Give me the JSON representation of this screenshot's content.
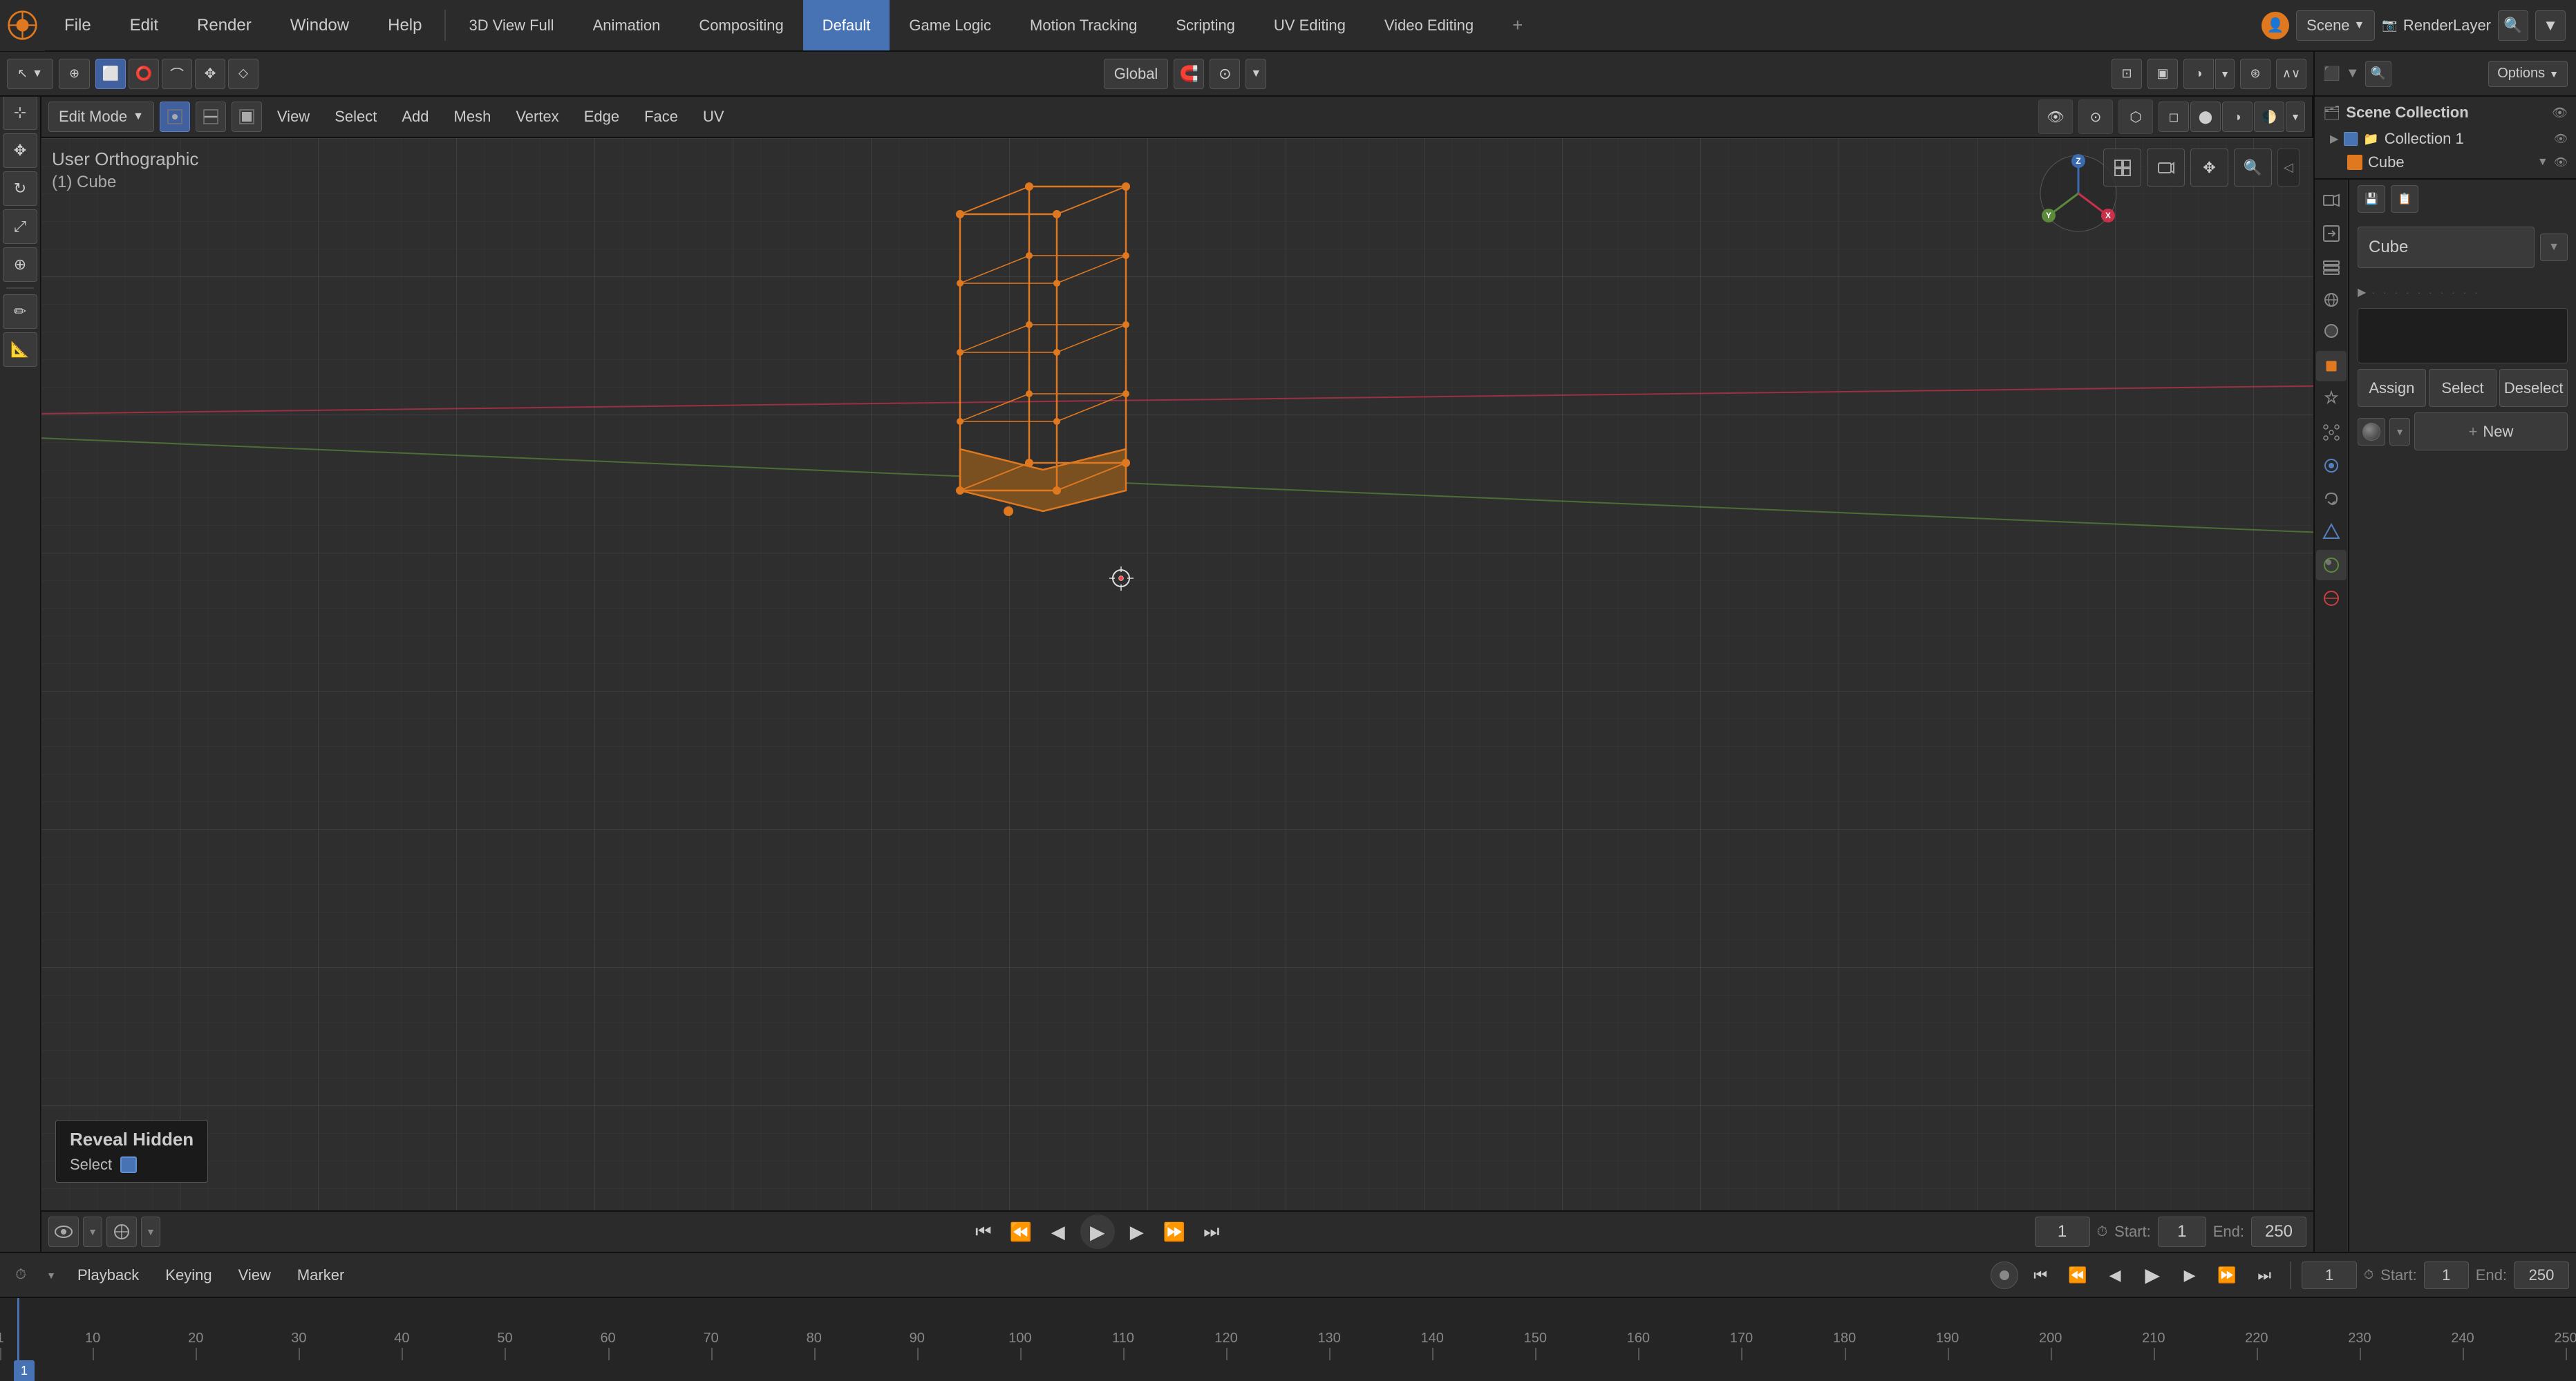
{
  "app": {
    "title": "Blender"
  },
  "top_menu": {
    "items": [
      {
        "id": "file",
        "label": "File"
      },
      {
        "id": "edit",
        "label": "Edit"
      },
      {
        "id": "render",
        "label": "Render"
      },
      {
        "id": "window",
        "label": "Window"
      },
      {
        "id": "help",
        "label": "Help"
      }
    ],
    "workspaces": [
      {
        "id": "3dview",
        "label": "3D View Full"
      },
      {
        "id": "animation",
        "label": "Animation"
      },
      {
        "id": "compositing",
        "label": "Compositing"
      },
      {
        "id": "default",
        "label": "Default",
        "active": true
      },
      {
        "id": "gamelogic",
        "label": "Game Logic"
      },
      {
        "id": "motiontracking",
        "label": "Motion Tracking"
      },
      {
        "id": "scripting",
        "label": "Scripting"
      },
      {
        "id": "uvediting",
        "label": "UV Editing"
      },
      {
        "id": "videoediting",
        "label": "Video Editing"
      }
    ],
    "add_workspace": "+",
    "scene_label": "Scene",
    "render_layer_label": "RenderLayer",
    "search_placeholder": "Search..."
  },
  "viewport": {
    "mode_label": "User Orthographic",
    "object_label": "(1) Cube",
    "transform_space": "Global",
    "global_dropdown_label": "Global",
    "cursor_label": "3D Cursor"
  },
  "viewport_header": {
    "mode": "Edit Mode",
    "menus": [
      "View",
      "Select",
      "Add",
      "Mesh",
      "Vertex",
      "Edge",
      "Face",
      "UV"
    ]
  },
  "left_tools": {
    "tools": [
      {
        "id": "select",
        "icon": "↖",
        "active": true
      },
      {
        "id": "move",
        "icon": "✥"
      },
      {
        "id": "rotate",
        "icon": "↻"
      },
      {
        "id": "scale",
        "icon": "⤢"
      },
      {
        "id": "transform",
        "icon": "⊕"
      },
      {
        "id": "annotate",
        "icon": "✏"
      },
      {
        "id": "measure",
        "icon": "📏"
      },
      {
        "id": "cursor",
        "icon": "⊹"
      }
    ]
  },
  "right_panel": {
    "scene_collection": {
      "title": "Scene Collection",
      "items": [
        {
          "label": "Collection 1",
          "icon": "folder",
          "visible": true,
          "children": [
            {
              "label": "Cube",
              "icon": "cube",
              "visible": true
            }
          ]
        }
      ]
    },
    "object_name": "Cube",
    "tabs": [
      {
        "id": "render",
        "icon": "📷",
        "active": false
      },
      {
        "id": "output",
        "icon": "🖨"
      },
      {
        "id": "view_layer",
        "icon": "🗂"
      },
      {
        "id": "scene",
        "icon": "🎬"
      },
      {
        "id": "world",
        "icon": "🌐"
      },
      {
        "id": "object",
        "icon": "🟧"
      },
      {
        "id": "modifier",
        "icon": "🔧"
      },
      {
        "id": "particles",
        "icon": "✨"
      },
      {
        "id": "physics",
        "icon": "🔵"
      },
      {
        "id": "constraint",
        "icon": "🔗"
      },
      {
        "id": "data",
        "icon": "△"
      },
      {
        "id": "material",
        "icon": "🟠",
        "active": true
      },
      {
        "id": "texture",
        "icon": "🔴"
      }
    ],
    "material": {
      "assign_label": "Assign",
      "select_label": "Select",
      "deselect_label": "Deselect",
      "new_label": "New",
      "add_icon": "+",
      "sphere_icon": "●"
    }
  },
  "bottom": {
    "edit_mode_label": "Edit Mode",
    "vert_btn": "▲",
    "edge_btn": "—",
    "face_btn": "□",
    "playback_label": "Playback",
    "keying_label": "Keying",
    "view_label": "View",
    "marker_label": "Marker",
    "play_icon": "▶",
    "frame_current": "1",
    "start_label": "Start:",
    "start_value": "1",
    "end_label": "End:",
    "end_value": "250",
    "frame_markers": [
      {
        "value": 1,
        "label": "1"
      },
      {
        "value": 10,
        "label": "10"
      },
      {
        "value": 20,
        "label": "20"
      },
      {
        "value": 30,
        "label": "30"
      },
      {
        "value": 40,
        "label": "40"
      },
      {
        "value": 50,
        "label": "50"
      },
      {
        "value": 60,
        "label": "60"
      },
      {
        "value": 70,
        "label": "70"
      },
      {
        "value": 80,
        "label": "80"
      },
      {
        "value": 90,
        "label": "90"
      },
      {
        "value": 100,
        "label": "100"
      },
      {
        "value": 110,
        "label": "110"
      },
      {
        "value": 120,
        "label": "120"
      },
      {
        "value": 130,
        "label": "130"
      },
      {
        "value": 140,
        "label": "140"
      },
      {
        "value": 150,
        "label": "150"
      },
      {
        "value": 160,
        "label": "160"
      },
      {
        "value": 170,
        "label": "170"
      },
      {
        "value": 180,
        "label": "180"
      },
      {
        "value": 190,
        "label": "190"
      },
      {
        "value": 200,
        "label": "200"
      },
      {
        "value": 210,
        "label": "210"
      },
      {
        "value": 220,
        "label": "220"
      },
      {
        "value": 230,
        "label": "230"
      },
      {
        "value": 240,
        "label": "240"
      },
      {
        "value": 250,
        "label": "250"
      }
    ]
  },
  "tooltip": {
    "title": "Reveal Hidden",
    "select_label": "Select",
    "check_checked": true
  },
  "colors": {
    "orange_selected": "#e07820",
    "blue_active": "#4772b3",
    "background_dark": "#2b2b2b",
    "viewport_bg": "#2e2e2e",
    "grid_line": "#383838",
    "axis_red": "#c8314a",
    "axis_green": "#5a8a3a",
    "axis_blue": "#3a6ab0"
  }
}
